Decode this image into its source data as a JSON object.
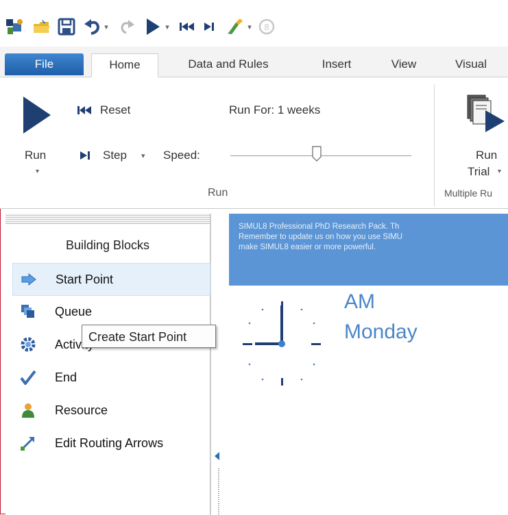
{
  "quick_access": {
    "icons": [
      "simul8-logo-icon",
      "open-folder-icon",
      "save-icon",
      "undo-icon",
      "redo-icon",
      "run-icon",
      "reset-icon",
      "step-icon",
      "wizard-icon",
      "help-icon"
    ]
  },
  "tabs": [
    "File",
    "Home",
    "Data and Rules",
    "Insert",
    "View",
    "Visual"
  ],
  "active_tab": "Home",
  "ribbon": {
    "run_label": "Run",
    "reset_label": "Reset",
    "step_label": "Step",
    "speed_label": "Speed:",
    "run_for_label": "Run For: 1 weeks",
    "run_trial_label_1": "Run",
    "run_trial_label_2": "Trial",
    "group_run_label": "Run",
    "group_multiple_label": "Multiple Ru"
  },
  "building_blocks": {
    "title": "Building Blocks",
    "items": [
      {
        "label": "Start Point",
        "icon": "start-point-arrow-icon"
      },
      {
        "label": "Queue",
        "icon": "queue-icon"
      },
      {
        "label": "Activity",
        "icon": "activity-gear-icon"
      },
      {
        "label": "End",
        "icon": "end-checkmark-icon"
      },
      {
        "label": "Resource",
        "icon": "resource-person-icon"
      },
      {
        "label": "Edit Routing Arrows",
        "icon": "routing-arrows-icon"
      }
    ]
  },
  "banner": {
    "line1": "SIMUL8 Professional PhD Research Pack. Th",
    "line2": "Remember to update us on how you use SIMU",
    "line3": "make SIMUL8 easier or more powerful."
  },
  "clock": {
    "ampm": "AM",
    "day": "Monday"
  },
  "tooltip": "Create Start Point",
  "colors": {
    "accent": "#2a6cb6",
    "banner": "#5b95d6",
    "clock_text": "#4a86c8",
    "frame": "#c8102e"
  }
}
